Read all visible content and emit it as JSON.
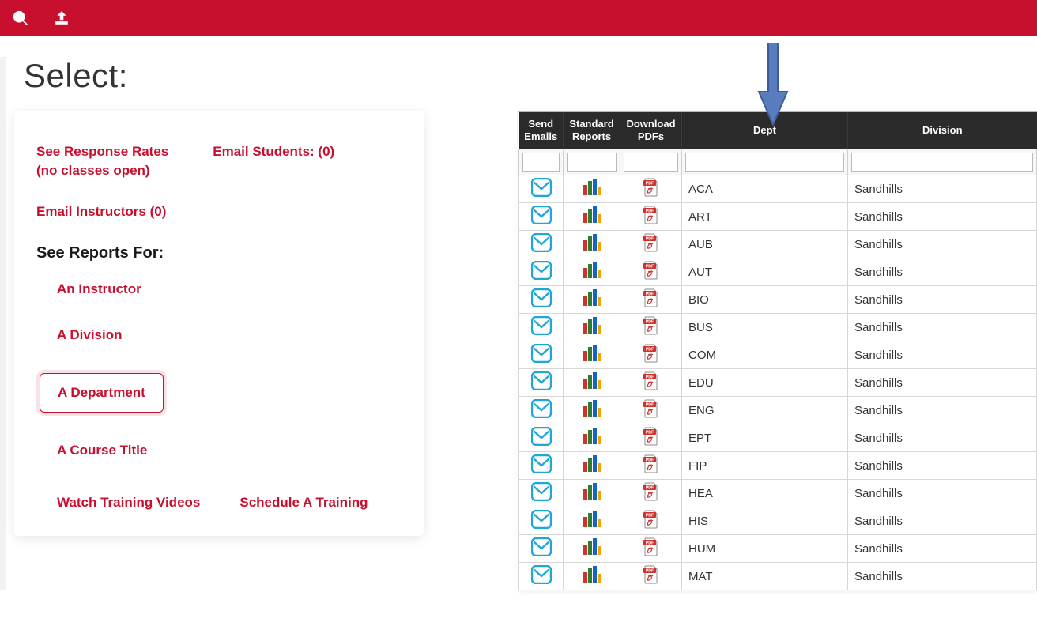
{
  "topbar": {
    "search_icon": "search",
    "upload_icon": "upload"
  },
  "page_title": "Select:",
  "left": {
    "response_rates_line1": "See Response Rates",
    "response_rates_line2": "(no classes open)",
    "email_students": "Email Students: (0)",
    "email_instructors": "Email Instructors (0)",
    "see_reports_heading": "See Reports For:",
    "nav": {
      "instructor": "An Instructor",
      "division": "A Division",
      "department": "A Department",
      "course_title": "A Course Title"
    },
    "watch_training": "Watch Training Videos",
    "schedule_training": "Schedule A Training"
  },
  "table": {
    "headers": {
      "send_emails": "Send Emails",
      "standard_reports": "Standard Reports",
      "download_pdfs": "Download PDFs",
      "dept": "Dept",
      "division": "Division"
    },
    "rows": [
      {
        "dept": "ACA",
        "division": "Sandhills"
      },
      {
        "dept": "ART",
        "division": "Sandhills"
      },
      {
        "dept": "AUB",
        "division": "Sandhills"
      },
      {
        "dept": "AUT",
        "division": "Sandhills"
      },
      {
        "dept": "BIO",
        "division": "Sandhills"
      },
      {
        "dept": "BUS",
        "division": "Sandhills"
      },
      {
        "dept": "COM",
        "division": "Sandhills"
      },
      {
        "dept": "EDU",
        "division": "Sandhills"
      },
      {
        "dept": "ENG",
        "division": "Sandhills"
      },
      {
        "dept": "EPT",
        "division": "Sandhills"
      },
      {
        "dept": "FIP",
        "division": "Sandhills"
      },
      {
        "dept": "HEA",
        "division": "Sandhills"
      },
      {
        "dept": "HIS",
        "division": "Sandhills"
      },
      {
        "dept": "HUM",
        "division": "Sandhills"
      },
      {
        "dept": "MAT",
        "division": "Sandhills"
      }
    ]
  }
}
